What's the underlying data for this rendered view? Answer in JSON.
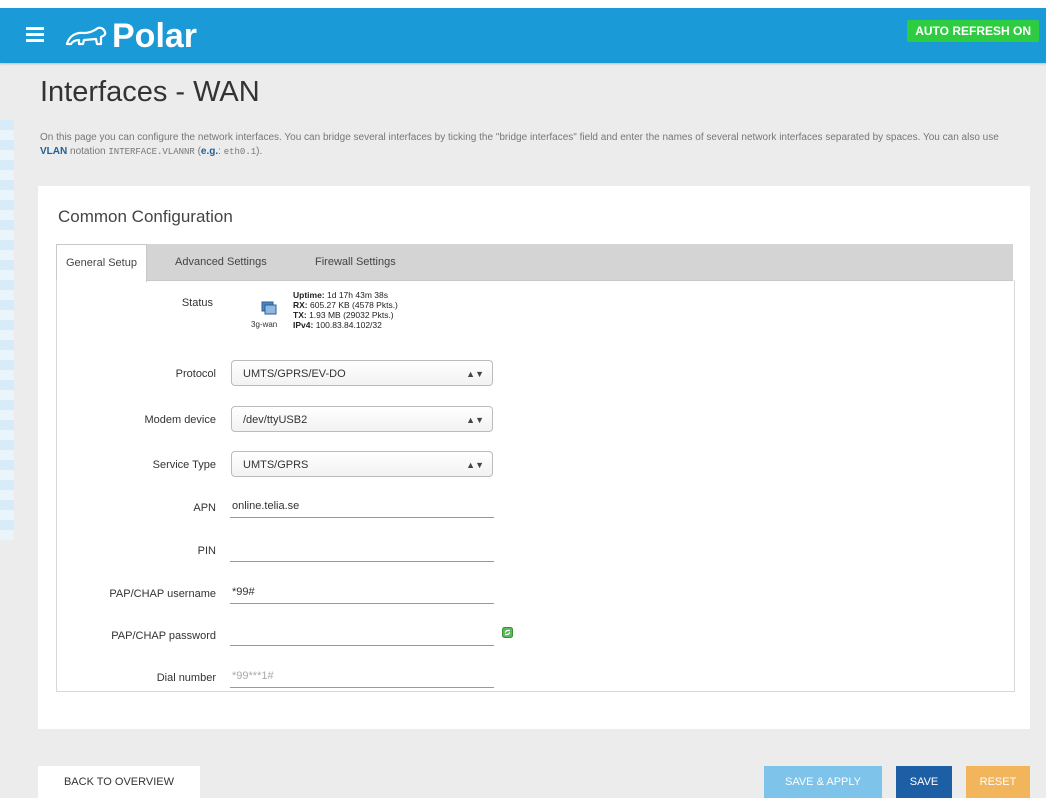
{
  "header": {
    "logo_text": "Polar",
    "auto_refresh_label": "AUTO REFRESH ON",
    "colors": {
      "bar": "#1a9bd7",
      "auto_refresh": "#2ecc40"
    }
  },
  "page": {
    "title": "Interfaces - WAN",
    "description_part1": "On this page you can configure the network interfaces. You can bridge several interfaces by ticking the \"bridge interfaces\" field and enter the names of several network interfaces separated by spaces. You can also use ",
    "vlan_link": "VLAN",
    "description_part2": " notation ",
    "notation_code": "INTERFACE.VLANNR",
    "description_part3": " (",
    "eg_link": "e.g.",
    "description_part4": ": ",
    "example_code": "eth0.1",
    "description_part5": ")."
  },
  "card": {
    "title": "Common Configuration",
    "tabs": [
      {
        "label": "General Setup",
        "active": true
      },
      {
        "label": "Advanced Settings",
        "active": false
      },
      {
        "label": "Firewall Settings",
        "active": false
      }
    ]
  },
  "status": {
    "label": "Status",
    "interface_name": "3g-wan",
    "uptime_key": "Uptime:",
    "uptime_value": " 1d 17h 43m 38s",
    "rx_key": "RX:",
    "rx_value": " 605.27 KB (4578 Pkts.)",
    "tx_key": "TX:",
    "tx_value": " 1.93 MB (29032 Pkts.)",
    "ipv4_key": "IPv4:",
    "ipv4_value": " 100.83.84.102/32"
  },
  "form": {
    "protocol": {
      "label": "Protocol",
      "value": "UMTS/GPRS/EV-DO"
    },
    "modem_device": {
      "label": "Modem device",
      "value": "/dev/ttyUSB2"
    },
    "service_type": {
      "label": "Service Type",
      "value": "UMTS/GPRS"
    },
    "apn": {
      "label": "APN",
      "value": "online.telia.se"
    },
    "pin": {
      "label": "PIN",
      "value": ""
    },
    "pap_username": {
      "label": "PAP/CHAP username",
      "value": "*99#"
    },
    "pap_password": {
      "label": "PAP/CHAP password",
      "value": ""
    },
    "dial_number": {
      "label": "Dial number",
      "placeholder": "*99***1#"
    },
    "select_arrows": "▲▼"
  },
  "footer": {
    "back_label": "BACK TO OVERVIEW",
    "save_apply_label": "SAVE & APPLY",
    "save_label": "SAVE",
    "reset_label": "RESET"
  }
}
